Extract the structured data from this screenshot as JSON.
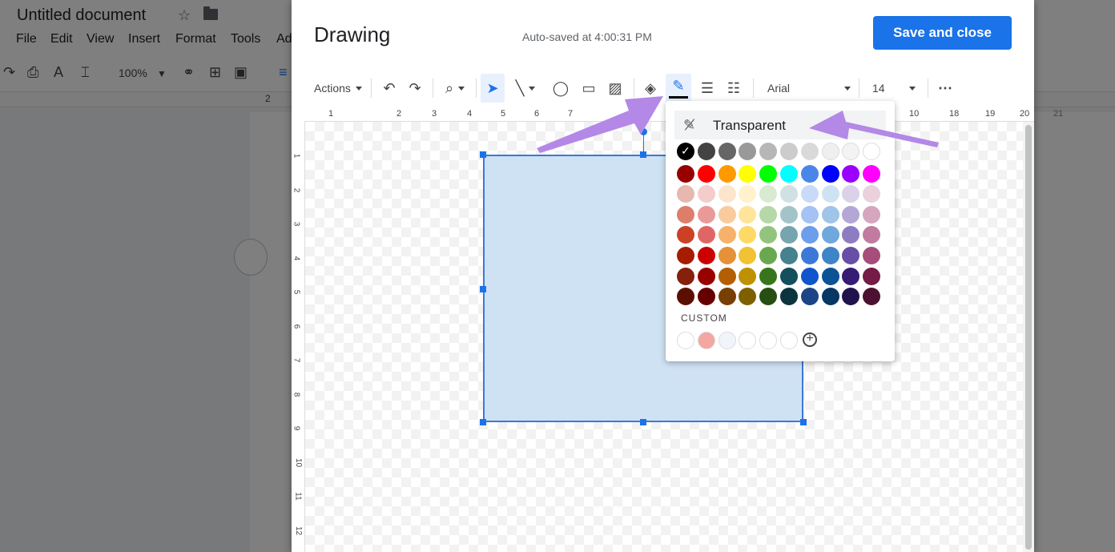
{
  "docs": {
    "title": "Untitled document",
    "menu": [
      "File",
      "Edit",
      "View",
      "Insert",
      "Format",
      "Tools",
      "Ad"
    ],
    "zoom": "100%",
    "ruler_label": "2"
  },
  "dialog": {
    "title": "Drawing",
    "autosave": "Auto-saved at 4:00:31 PM",
    "save_label": "Save and close",
    "toolbar": {
      "actions": "Actions",
      "font": "Arial",
      "size": "14"
    },
    "ruler_h": [
      "1",
      "2",
      "3",
      "4",
      "5",
      "6",
      "7",
      "8",
      "10",
      "18",
      "19",
      "20",
      "21"
    ],
    "ruler_v": [
      "1",
      "2",
      "3",
      "4",
      "5",
      "6",
      "7",
      "8",
      "9",
      "10",
      "11",
      "12"
    ]
  },
  "color_popup": {
    "transparent_label": "Transparent",
    "custom_label": "CUSTOM",
    "grid": [
      [
        "#000000",
        "#434343",
        "#666666",
        "#999999",
        "#b7b7b7",
        "#cccccc",
        "#d9d9d9",
        "#efefef",
        "#f3f3f3",
        "#ffffff"
      ],
      [
        "#980000",
        "#ff0000",
        "#ff9900",
        "#ffff00",
        "#00ff00",
        "#00ffff",
        "#4a86e8",
        "#0000ff",
        "#9900ff",
        "#ff00ff"
      ],
      [
        "#e6b8af",
        "#f4cccc",
        "#fce5cd",
        "#fff2cc",
        "#d9ead3",
        "#d0e0e3",
        "#c9daf8",
        "#cfe2f3",
        "#d9d2e9",
        "#ead1dc"
      ],
      [
        "#dd7e6b",
        "#ea9999",
        "#f9cb9c",
        "#ffe599",
        "#b6d7a8",
        "#a2c4c9",
        "#a4c2f4",
        "#9fc5e8",
        "#b4a7d6",
        "#d5a6bd"
      ],
      [
        "#cc4125",
        "#e06666",
        "#f6b26b",
        "#ffd966",
        "#93c47d",
        "#76a5af",
        "#6d9eeb",
        "#6fa8dc",
        "#8e7cc3",
        "#c27ba0"
      ],
      [
        "#a61c00",
        "#cc0000",
        "#e69138",
        "#f1c232",
        "#6aa84f",
        "#45818e",
        "#3c78d8",
        "#3d85c6",
        "#674ea7",
        "#a64d79"
      ],
      [
        "#85200c",
        "#990000",
        "#b45f06",
        "#bf9000",
        "#38761d",
        "#134f5c",
        "#1155cc",
        "#0b5394",
        "#351c75",
        "#741b47"
      ],
      [
        "#5b0f00",
        "#660000",
        "#783f04",
        "#7f6000",
        "#274e13",
        "#0c343d",
        "#1c4587",
        "#073763",
        "#20124d",
        "#4c1130"
      ]
    ],
    "custom_colors": [
      "#ffffff",
      "#f4a7a0",
      "#f1f4fb",
      "#ffffff",
      "#ffffff",
      "#ffffff"
    ],
    "selected": "#000000"
  },
  "colors": {
    "accent": "#1a73e8",
    "arrow": "#b388e6",
    "shape_fill": "#cfe2f3"
  }
}
